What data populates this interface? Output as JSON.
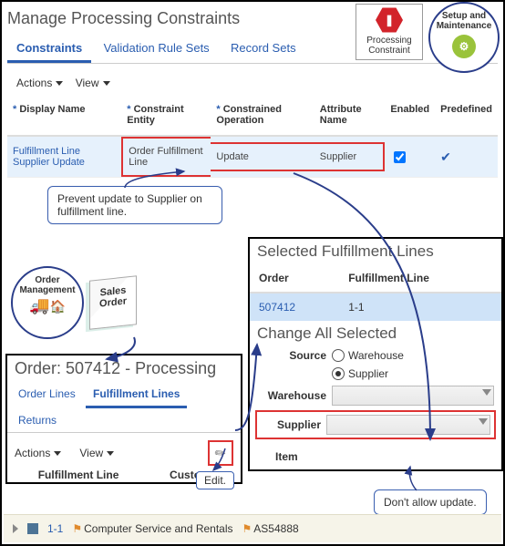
{
  "top": {
    "title": "Manage Processing Constraints",
    "tabs": [
      "Constraints",
      "Validation Rule Sets",
      "Record Sets"
    ],
    "actions_label": "Actions",
    "view_label": "View",
    "cols": {
      "display_name": "Display Name",
      "constraint_entity": "Constraint Entity",
      "constrained_operation": "Constrained Operation",
      "attribute_name": "Attribute Name",
      "enabled": "Enabled",
      "predefined": "Predefined"
    },
    "row": {
      "display_name": "Fulfillment Line Supplier Update",
      "constraint_entity": "Order Fulfillment Line",
      "constrained_operation": "Update",
      "attribute_name": "Supplier"
    },
    "pc_badge": "Processing Constraint",
    "setup_badge": "Setup and Maintenance"
  },
  "callouts": {
    "prevent": "Prevent update to Supplier on fulfillment line.",
    "edit": "Edit.",
    "dont_allow": "Don't allow update."
  },
  "om_cluster": {
    "order_mgmt": "Order Management",
    "sales_order": "Sales Order"
  },
  "sfl": {
    "title": "Selected Fulfillment Lines",
    "cols": {
      "order": "Order",
      "fline": "Fulfillment Line"
    },
    "row": {
      "order": "507412",
      "fline": "1-1"
    },
    "change_title": "Change All Selected",
    "source_label": "Source",
    "source_options": {
      "warehouse": "Warehouse",
      "supplier": "Supplier"
    },
    "warehouse_label": "Warehouse",
    "supplier_label": "Supplier",
    "item_label": "Item"
  },
  "order": {
    "title": "Order: 507412 - Processing",
    "tabs": [
      "Order Lines",
      "Fulfillment Lines",
      "Returns"
    ],
    "actions_label": "Actions",
    "view_label": "View",
    "cols": {
      "fline": "Fulfillment Line",
      "customer": "Customer"
    }
  },
  "bottom": {
    "fline": "1-1",
    "customer": "Computer Service and Rentals",
    "item": "AS54888"
  }
}
